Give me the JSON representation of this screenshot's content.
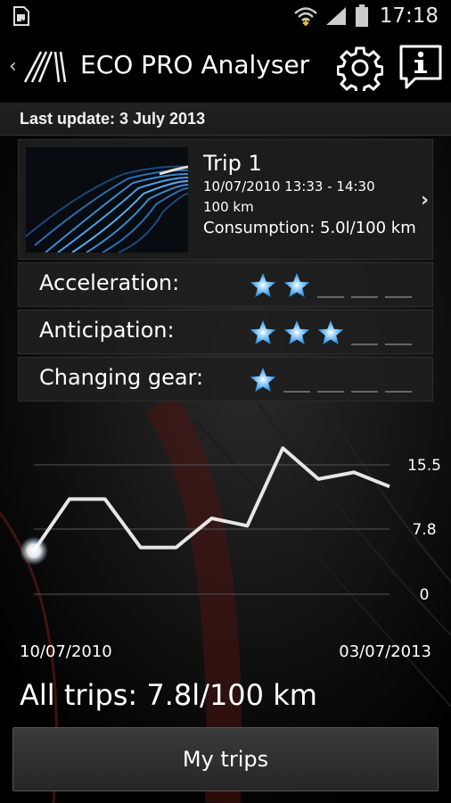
{
  "status_bar": {
    "time": "17:18",
    "icons": [
      "sim-card-icon",
      "wifi-icon",
      "signal-icon",
      "battery-icon"
    ]
  },
  "action_bar": {
    "title": "ECO PRO Analyser",
    "icons": [
      "back-chevron-icon",
      "road-logo-icon",
      "gear-icon",
      "info-icon"
    ]
  },
  "last_update": "Last update: 3 July 2013",
  "trip": {
    "title": "Trip 1",
    "datetime": "10/07/2010 13:33 - 14:30",
    "distance": "100 km",
    "consumption": "Consumption: 5.0l/100 km"
  },
  "ratings": [
    {
      "label": "Acceleration:",
      "stars": 2,
      "max": 5
    },
    {
      "label": "Anticipation:",
      "stars": 3,
      "max": 5
    },
    {
      "label": "Changing gear:",
      "stars": 1,
      "max": 5
    }
  ],
  "chart_data": {
    "type": "line",
    "y_ticks": [
      "15.5",
      "7.8",
      "0"
    ],
    "ylim": [
      0,
      15.5
    ],
    "x_start_label": "10/07/2010",
    "x_end_label": "03/07/2013",
    "values": [
      5.2,
      11.4,
      11.4,
      5.6,
      5.6,
      9.1,
      8.2,
      17.5,
      13.8,
      14.6,
      12.9
    ],
    "highlight_index": 0
  },
  "summary": "All trips: 7.8l/100 km",
  "button": {
    "label": "My trips"
  },
  "colors": {
    "accent_blue": "#1f8fe0",
    "line": "#e6e6e6",
    "background": "#000000"
  }
}
